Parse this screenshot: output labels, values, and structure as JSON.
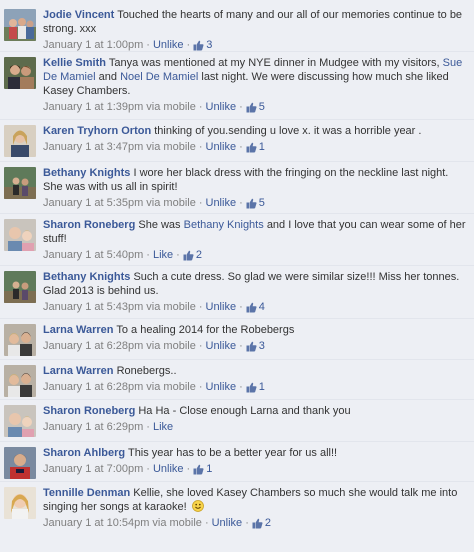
{
  "comments": [
    {
      "author": "Jodie Vincent",
      "text": "Touched the hearts of many and our all of our memories continue to be strong. xxx",
      "time": "January 1 at 1:00pm",
      "via": "",
      "action": "Unlike",
      "likes": "3"
    },
    {
      "author": "Kellie Smith",
      "text_before": "Tanya was mentioned at my NYE dinner in Mudgee with my visitors,",
      "mention1": "Sue De Mamiel",
      "text_mid": "and",
      "mention2": "Noel De Mamiel",
      "text_after": "last night. We were discussing how much she liked Kasey Chambers.",
      "time": "January 1 at 1:39pm",
      "via": "via mobile",
      "action": "Unlike",
      "likes": "5"
    },
    {
      "author": "Karen Tryhorn Orton",
      "text": "thinking of you.sending u love x. it was a horrible year .",
      "time": "January 1 at 3:47pm",
      "via": "via mobile",
      "action": "Unlike",
      "likes": "1"
    },
    {
      "author": "Bethany Knights",
      "text": "I wore her black dress with the fringing on the neckline last night. She was with us all in spirit!",
      "time": "January 1 at 5:35pm",
      "via": "via mobile",
      "action": "Unlike",
      "likes": "5"
    },
    {
      "author": "Sharon Roneberg",
      "text_before": "She was",
      "mention1": "Bethany Knights",
      "text_after": "and I love that you can wear some of her stuff!",
      "time": "January 1 at 5:40pm",
      "via": "",
      "action": "Like",
      "likes": "2"
    },
    {
      "author": "Bethany Knights",
      "text": "Such a cute dress. So glad we were similar size!!! Miss her tonnes. Glad 2013 is behind us.",
      "time": "January 1 at 5:43pm",
      "via": "via mobile",
      "action": "Unlike",
      "likes": "4"
    },
    {
      "author": "Larna Warren",
      "text": "To a healing 2014 for the Robebergs",
      "time": "January 1 at 6:28pm",
      "via": "via mobile",
      "action": "Unlike",
      "likes": "3"
    },
    {
      "author": "Larna Warren",
      "text": "Ronebergs..",
      "time": "January 1 at 6:28pm",
      "via": "via mobile",
      "action": "Unlike",
      "likes": "1"
    },
    {
      "author": "Sharon Roneberg",
      "text": "Ha Ha - Close enough Larna and thank you",
      "time": "January 1 at 6:29pm",
      "via": "",
      "action": "Like",
      "likes": ""
    },
    {
      "author": "Sharon Ahlberg",
      "text": "This year has to be a better year for us all!!",
      "time": "January 1 at 7:00pm",
      "via": "",
      "action": "Unlike",
      "likes": "1"
    },
    {
      "author": "Tennille Denman",
      "text": "Kellie, she loved Kasey Chambers so much she would talk me into singing her songs at karaoke!",
      "time": "January 1 at 10:54pm",
      "via": "via mobile",
      "action": "Unlike",
      "likes": "2"
    }
  ],
  "sep": "·",
  "colors": {
    "link": "#3b5998",
    "text": "#333333",
    "meta": "#7f7f7f",
    "background": "#edeff4"
  },
  "icons": {
    "like": "thumbs-up-icon",
    "emoticon": "smiley-icon"
  }
}
